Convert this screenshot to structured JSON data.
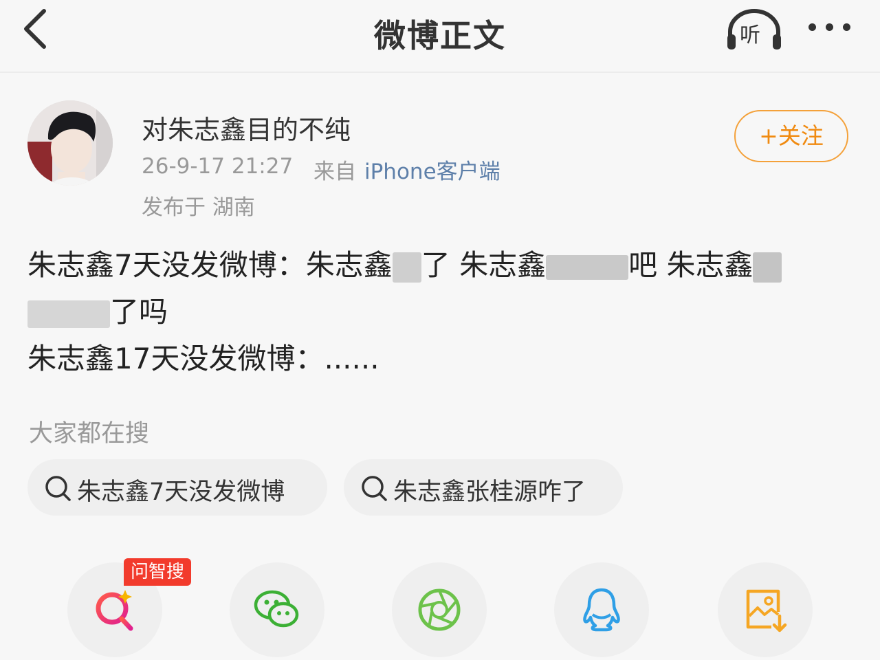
{
  "header": {
    "title": "微博正文",
    "listen_label": "听"
  },
  "post": {
    "username": "对朱志鑫目的不纯",
    "timestamp": "26-9-17 21:27",
    "source_prefix": "来自",
    "source_client": "iPhone客户端",
    "location": "发布于 湖南",
    "follow_label": "+关注",
    "line1_a": "朱志鑫7天没发微博：朱志鑫",
    "line1_b": "了 朱志鑫",
    "line1_c": "吧 朱志鑫",
    "line2": "了吗",
    "line3": "朱志鑫17天没发微博：......"
  },
  "search": {
    "label": "大家都在搜",
    "chips": [
      "朱志鑫7天没发微博",
      "朱志鑫张桂源咋了"
    ]
  },
  "share": {
    "ai_badge": "问智搜"
  },
  "colors": {
    "accent_orange": "#f08a10",
    "link_blue": "#5d7fa9",
    "badge_red": "#f23b2c",
    "wechat_green": "#3cb035",
    "moments_green": "#6cc24a",
    "qq_blue": "#2f9fe6",
    "save_orange": "#f5a623"
  },
  "icons": [
    "back-icon",
    "headphones-icon",
    "more-icon",
    "search-icon",
    "ai-search-icon",
    "wechat-icon",
    "moments-icon",
    "qq-icon",
    "save-image-icon"
  ]
}
